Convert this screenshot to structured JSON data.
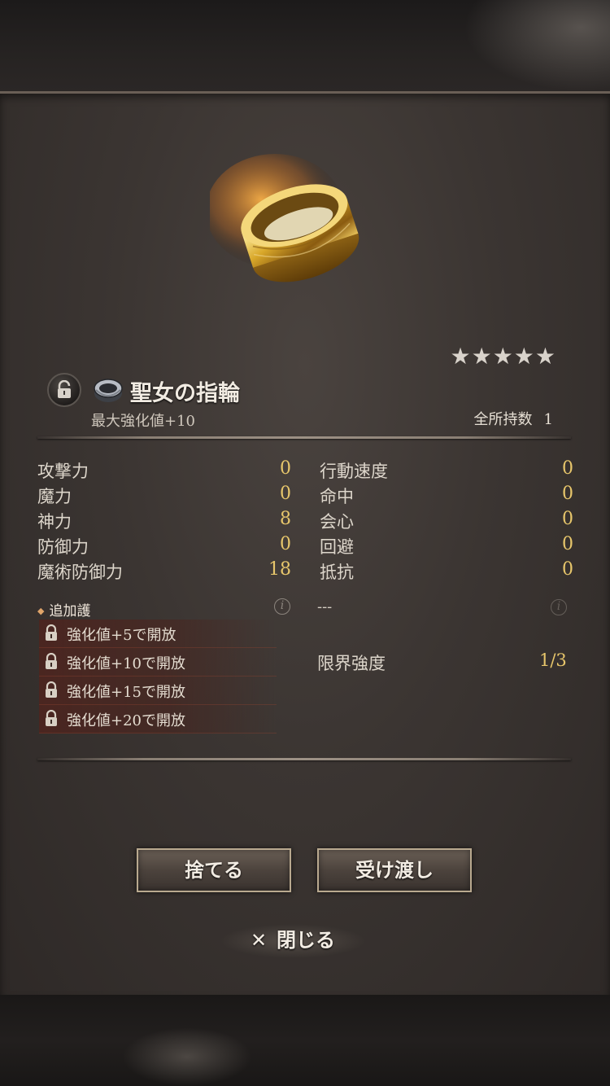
{
  "item": {
    "name": "聖女の指輪",
    "sub": "最大強化値+10",
    "stars": "★★★★★",
    "owned_label": "全所持数",
    "owned_count": "1"
  },
  "stats_left": [
    {
      "label": "攻撃力",
      "value": "0"
    },
    {
      "label": "魔力",
      "value": "0"
    },
    {
      "label": "神力",
      "value": "8"
    },
    {
      "label": "防御力",
      "value": "0"
    },
    {
      "label": "魔術防御力",
      "value": "18"
    }
  ],
  "stats_right": [
    {
      "label": "行動速度",
      "value": "0"
    },
    {
      "label": "命中",
      "value": "0"
    },
    {
      "label": "会心",
      "value": "0"
    },
    {
      "label": "回避",
      "value": "0"
    },
    {
      "label": "抵抗",
      "value": "0"
    }
  ],
  "additional": {
    "title": "追加護",
    "right_text": "---",
    "unlocks": [
      "強化値+5で開放",
      "強化値+10で開放",
      "強化値+15で開放",
      "強化値+20で開放"
    ]
  },
  "limit": {
    "label": "限界強度",
    "value": "1/3"
  },
  "buttons": {
    "discard": "捨てる",
    "transfer": "受け渡し",
    "close": "閉じる"
  },
  "colors": {
    "stat_value": "#e7c66b",
    "panel": "#3b3532",
    "accent_red": "#5c1e16"
  },
  "icons": {
    "lock": "lock-icon",
    "ring": "ring-icon",
    "close": "close-icon",
    "info": "info-icon"
  }
}
